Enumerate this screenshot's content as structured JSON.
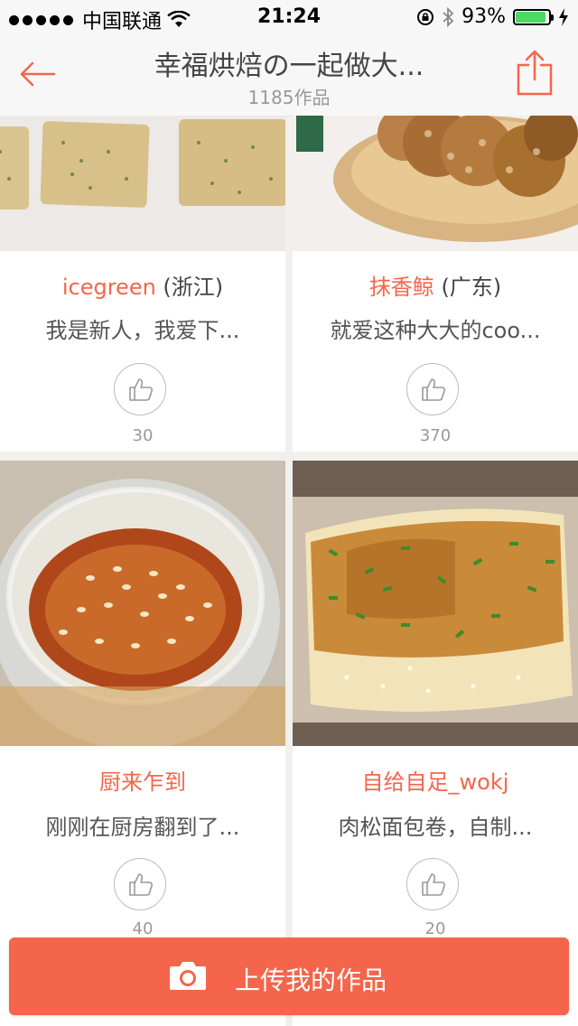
{
  "status_bar": {
    "carrier": "中国联通",
    "time": "21:24",
    "battery_percent": "93%",
    "battery_level": 0.93
  },
  "nav": {
    "title": "幸福烘焙の一起做大...",
    "subtitle": "1185作品"
  },
  "cards": [
    {
      "author_name": "icegreen",
      "region": " (浙江)",
      "description": "我是新人，我爱下...",
      "likes": "30"
    },
    {
      "author_name": "抹香鲸",
      "region": " (广东)",
      "description": "就爱这种大大的coo...",
      "likes": "370"
    },
    {
      "author_name": "厨来乍到",
      "region": "",
      "description": "刚刚在厨房翻到了...",
      "likes": "40"
    },
    {
      "author_name": "自给自足_wokj",
      "region": "",
      "description": "肉松面包卷，自制...",
      "likes": "20"
    }
  ],
  "upload_button": {
    "label": "上传我的作品"
  },
  "colors": {
    "accent": "#f4664a",
    "upload_bg": "#f4654b",
    "background": "#f2f0ec"
  },
  "icons": [
    "back-arrow-icon",
    "share-icon",
    "thumbs-up-icon",
    "camera-icon",
    "wifi-icon",
    "bluetooth-icon",
    "lock-rotation-icon",
    "battery-icon"
  ]
}
